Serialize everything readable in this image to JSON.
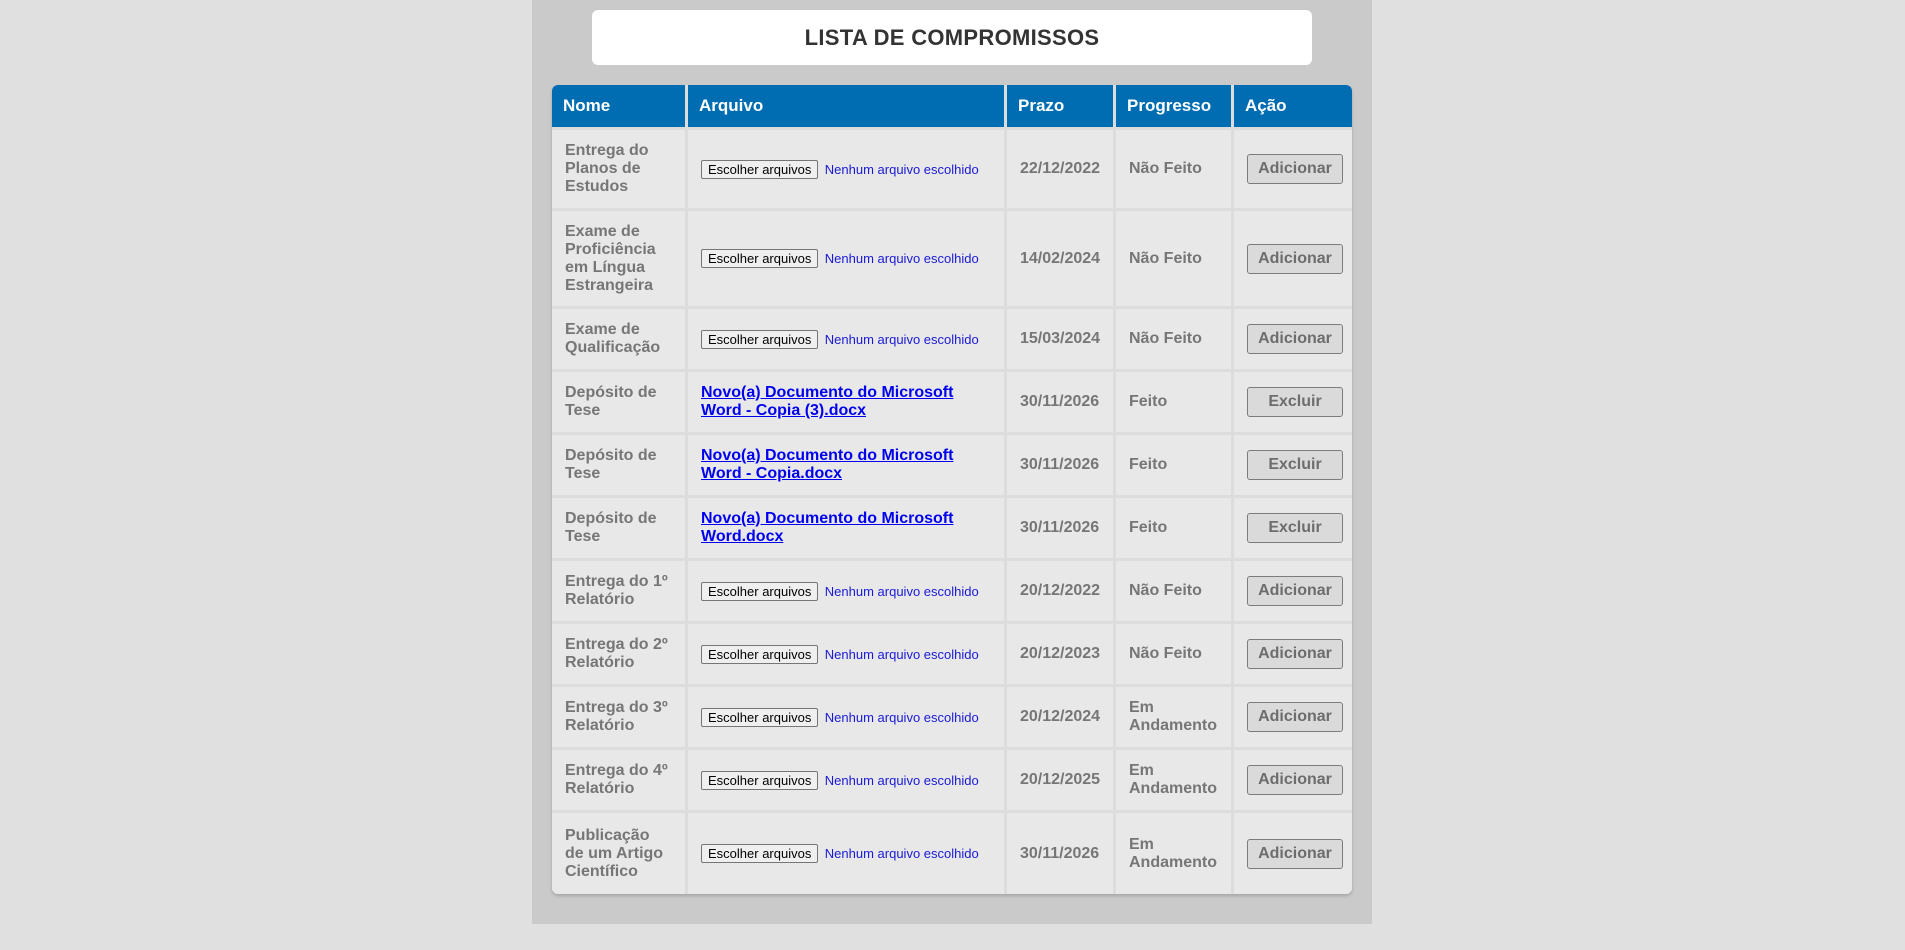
{
  "title": "LISTA DE COMPROMISSOS",
  "columns": [
    "Nome",
    "Arquivo",
    "Prazo",
    "Progresso",
    "Ação"
  ],
  "file_input": {
    "button_label": "Escolher arquivos",
    "empty_label": "Nenhum arquivo escolhido"
  },
  "rows": [
    {
      "nome": "Entrega do Planos de Estudos",
      "arquivo": "",
      "prazo": "22/12/2022",
      "progresso": "Não Feito",
      "acao": "Adicionar"
    },
    {
      "nome": "Exame de Proficiência em Língua Estrangeira",
      "arquivo": "",
      "prazo": "14/02/2024",
      "progresso": "Não Feito",
      "acao": "Adicionar"
    },
    {
      "nome": "Exame de Qualificação",
      "arquivo": "",
      "prazo": "15/03/2024",
      "progresso": "Não Feito",
      "acao": "Adicionar"
    },
    {
      "nome": "Depósito de Tese",
      "arquivo": "Novo(a) Documento do Microsoft Word - Copia (3).docx",
      "prazo": "30/11/2026",
      "progresso": "Feito",
      "acao": "Excluir"
    },
    {
      "nome": "Depósito de Tese",
      "arquivo": "Novo(a) Documento do Microsoft Word - Copia.docx",
      "prazo": "30/11/2026",
      "progresso": "Feito",
      "acao": "Excluir"
    },
    {
      "nome": "Depósito de Tese",
      "arquivo": "Novo(a) Documento do Microsoft Word.docx",
      "prazo": "30/11/2026",
      "progresso": "Feito",
      "acao": "Excluir"
    },
    {
      "nome": "Entrega do 1º Relatório",
      "arquivo": "",
      "prazo": "20/12/2022",
      "progresso": "Não Feito",
      "acao": "Adicionar"
    },
    {
      "nome": "Entrega do 2º Relatório",
      "arquivo": "",
      "prazo": "20/12/2023",
      "progresso": "Não Feito",
      "acao": "Adicionar"
    },
    {
      "nome": "Entrega do 3º Relatório",
      "arquivo": "",
      "prazo": "20/12/2024",
      "progresso": "Em Andamento",
      "acao": "Adicionar"
    },
    {
      "nome": "Entrega do 4º Relatório",
      "arquivo": "",
      "prazo": "20/12/2025",
      "progresso": "Em Andamento",
      "acao": "Adicionar"
    },
    {
      "nome": "Publicação de um Artigo Científico",
      "arquivo": "",
      "prazo": "30/11/2026",
      "progresso": "Em Andamento",
      "acao": "Adicionar"
    }
  ],
  "colors": {
    "header_bg": "#006db2",
    "page_bg": "#e0e0e0",
    "container_bg": "#cacaca",
    "cell_bg": "#e8e8e8",
    "link": "#0000ee"
  }
}
